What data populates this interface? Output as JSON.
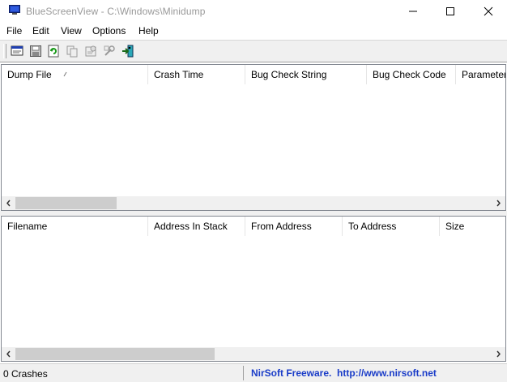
{
  "window": {
    "title": "BlueScreenView  -  C:\\Windows\\Minidump"
  },
  "menu": [
    "File",
    "Edit",
    "View",
    "Options",
    "Help"
  ],
  "toolbar": {
    "buttons": [
      "html-report-icon",
      "save-icon",
      "refresh-icon",
      "copy-icon",
      "properties-icon",
      "advanced-options-icon",
      "exit-icon"
    ]
  },
  "crash_list": {
    "columns": [
      "Dump File",
      "Crash Time",
      "Bug Check String",
      "Bug Check Code",
      "Parameter"
    ]
  },
  "driver_list": {
    "columns": [
      "Filename",
      "Address In Stack",
      "From Address",
      "To Address",
      "Size"
    ]
  },
  "status": {
    "count": "0 Crashes",
    "link": "NirSoft Freeware.  http://www.nirsoft.net"
  },
  "colors": {
    "link": "#1a3cc8",
    "toolbar_bg": "#f0f0f0",
    "scroll_thumb": "#cdcdcd"
  }
}
